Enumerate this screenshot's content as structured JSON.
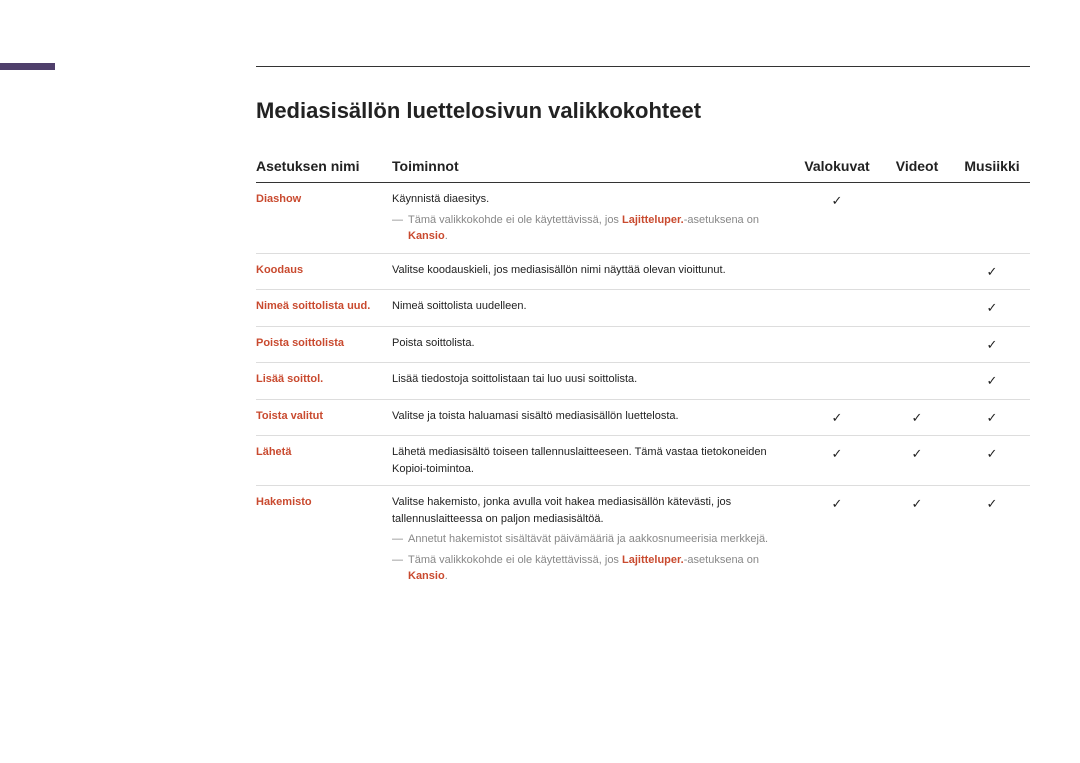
{
  "title": "Mediasisällön luettelosivun valikkokohteet",
  "headers": {
    "name": "Asetuksen nimi",
    "func": "Toiminnot",
    "photo": "Valokuvat",
    "video": "Videot",
    "music": "Musiikki"
  },
  "check": "✓",
  "rows": [
    {
      "name": "Diashow",
      "func": "Käynnistä diaesitys.",
      "note_pre": "Tämä valikkokohde ei ole käytettävissä, jos ",
      "note_hl": "Lajitteluper.",
      "note_mid": "-asetuksena on ",
      "note_hl2": "Kansio",
      "note_post": ".",
      "photo": true,
      "video": false,
      "music": false
    },
    {
      "name": "Koodaus",
      "func": "Valitse koodauskieli, jos mediasisällön nimi näyttää olevan vioittunut.",
      "photo": false,
      "video": false,
      "music": true
    },
    {
      "name": "Nimeä soittolista uud.",
      "func": "Nimeä soittolista uudelleen.",
      "photo": false,
      "video": false,
      "music": true
    },
    {
      "name": "Poista soittolista",
      "func": "Poista soittolista.",
      "photo": false,
      "video": false,
      "music": true
    },
    {
      "name": "Lisää soittol.",
      "func": "Lisää tiedostoja soittolistaan tai luo uusi soittolista.",
      "photo": false,
      "video": false,
      "music": true
    },
    {
      "name": "Toista valitut",
      "func": "Valitse ja toista haluamasi sisältö mediasisällön luettelosta.",
      "photo": true,
      "video": true,
      "music": true
    },
    {
      "name": "Lähetä",
      "func": "Lähetä mediasisältö toiseen tallennuslaitteeseen. Tämä vastaa tietokoneiden Kopioi-toimintoa.",
      "photo": true,
      "video": true,
      "music": true
    },
    {
      "name": "Hakemisto",
      "func": "Valitse hakemisto, jonka avulla voit hakea mediasisällön kätevästi, jos tallennuslaitteessa on paljon mediasisältöä.",
      "note1": "Annetut hakemistot sisältävät päivämääriä ja aakkosnumeerisia merkkejä.",
      "note_pre": "Tämä valikkokohde ei ole käytettävissä, jos ",
      "note_hl": "Lajitteluper.",
      "note_mid": "-asetuksena on ",
      "note_hl2": "Kansio",
      "note_post": ".",
      "photo": true,
      "video": true,
      "music": true,
      "last": true
    }
  ]
}
